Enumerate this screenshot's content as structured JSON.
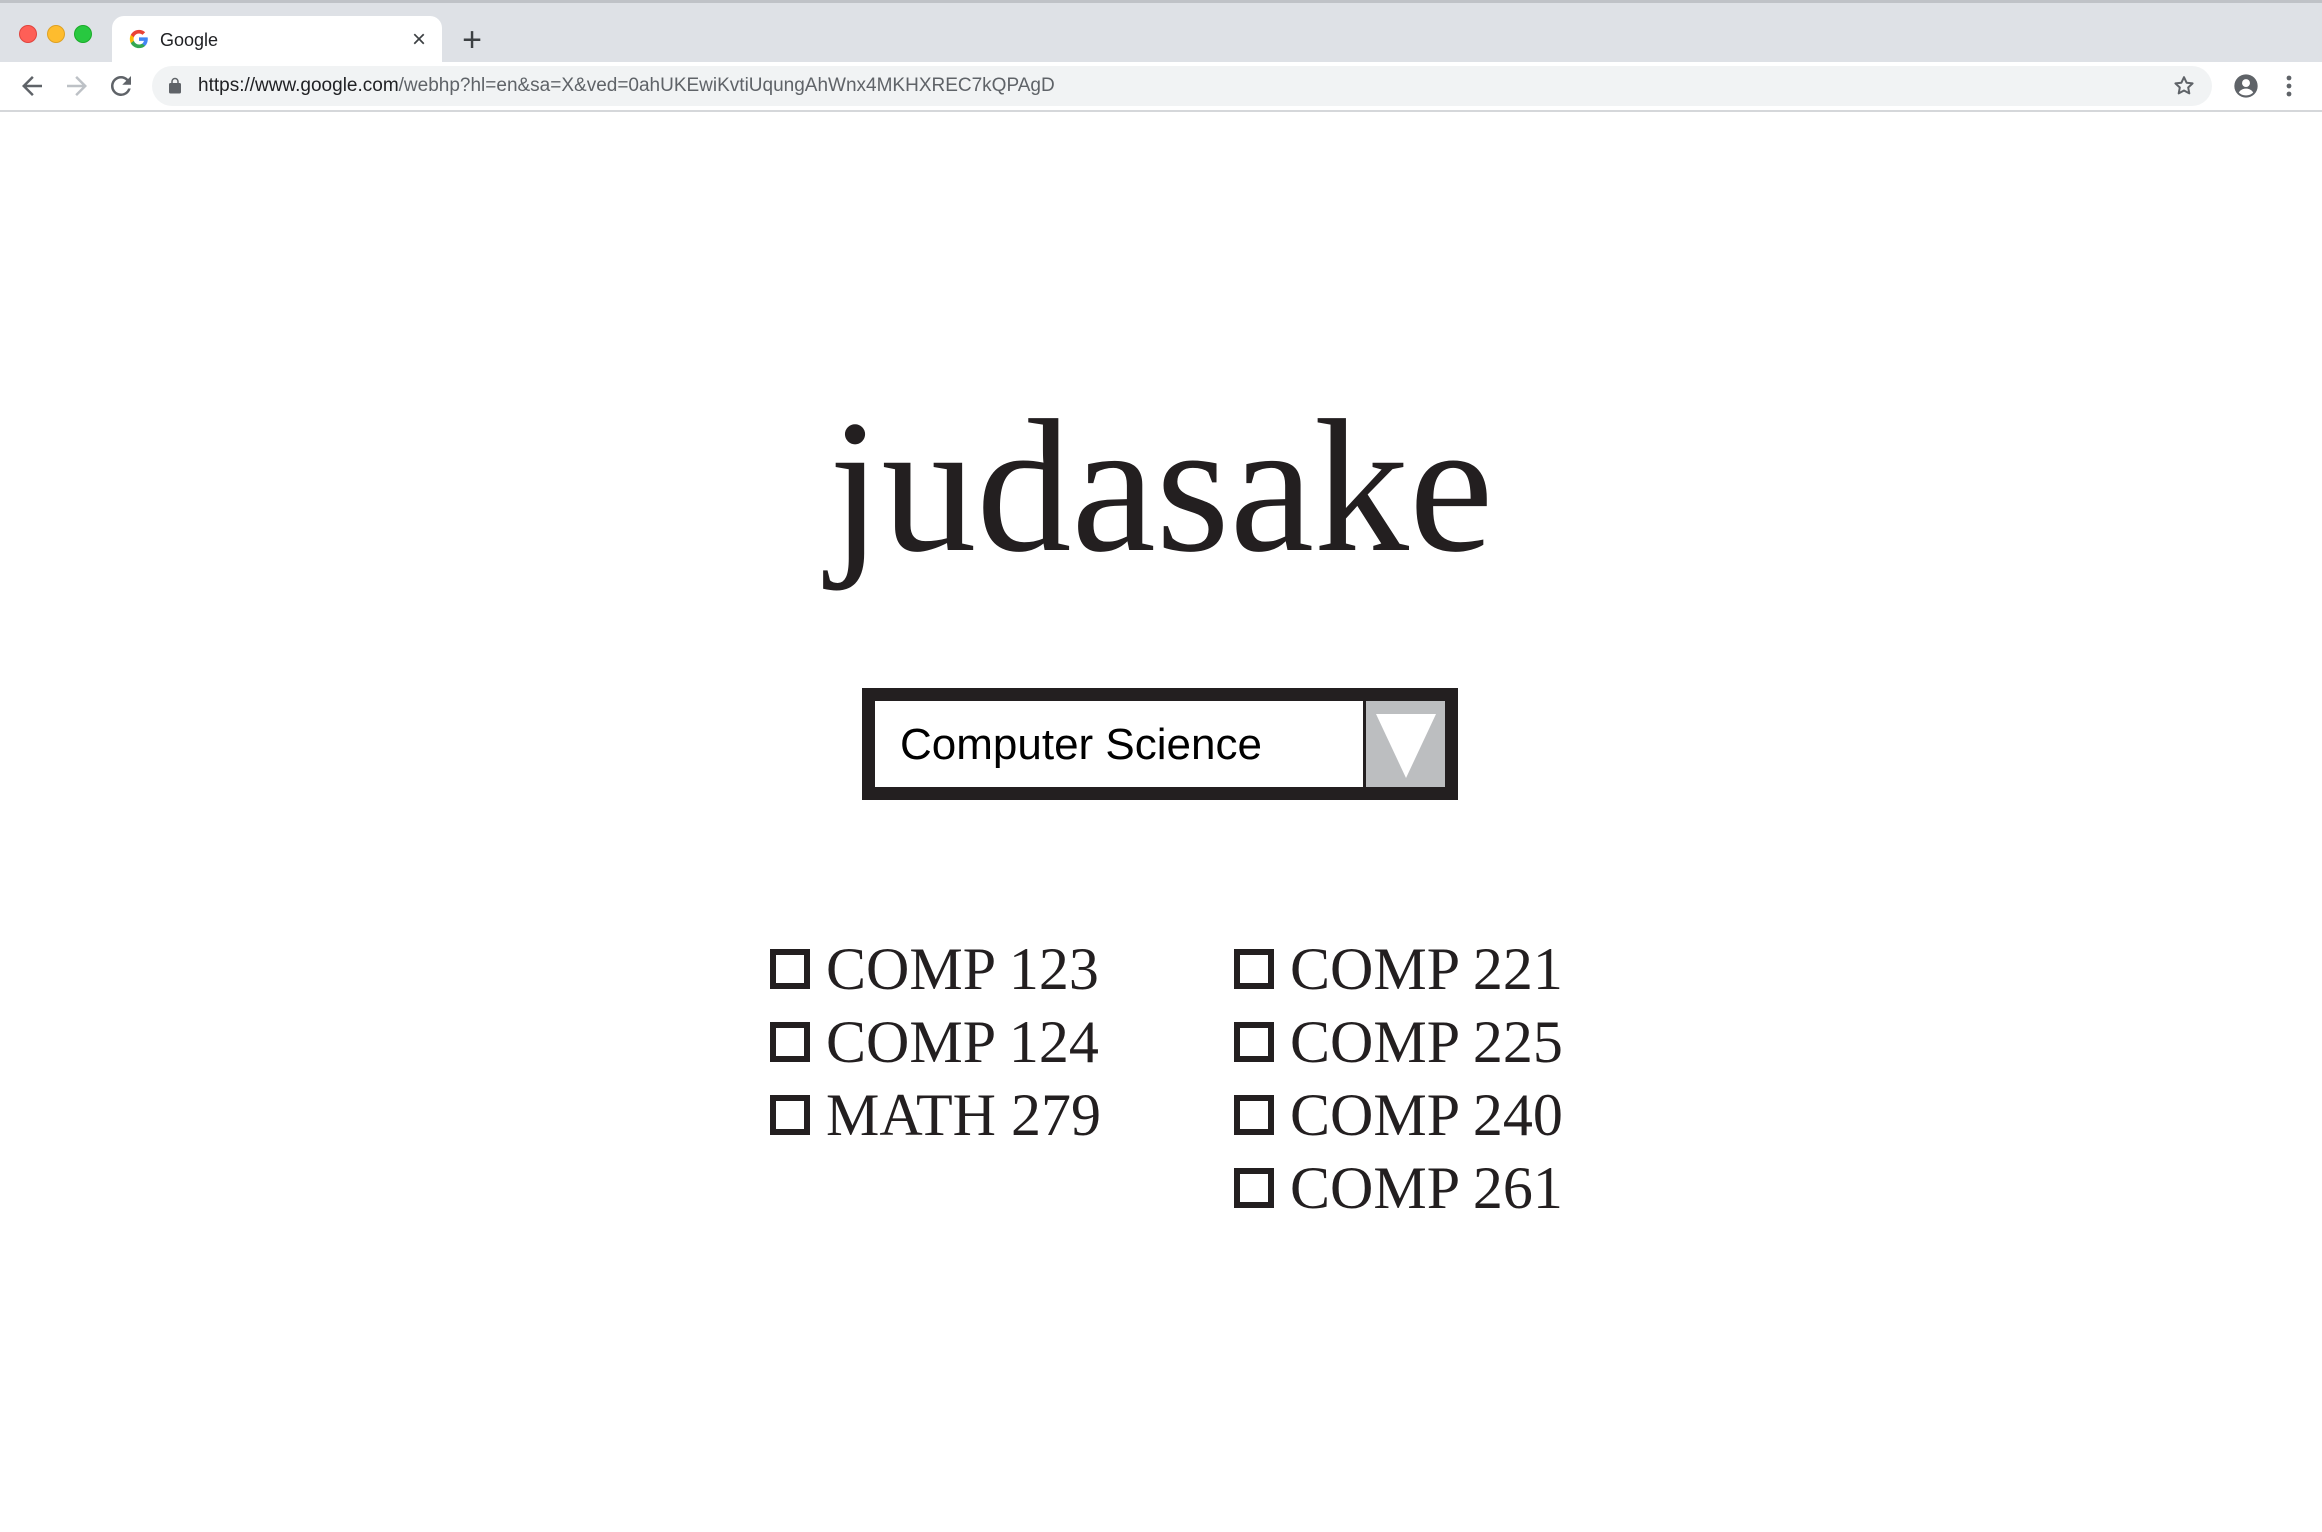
{
  "browser": {
    "tab": {
      "title": "Google",
      "close_glyph": "×",
      "favicon": "google-g-icon"
    },
    "new_tab_glyph": "+",
    "address_bar": {
      "url_host": "https://www.google.com",
      "url_path": "/webhp?hl=en&sa=X&ved=0ahUKEwiKvtiUqungAhWnx4MKHXREC7kQPAgD"
    },
    "icons": {
      "back": "back-arrow-icon",
      "forward": "forward-arrow-icon",
      "reload": "reload-icon",
      "lock": "lock-icon",
      "star": "bookmark-star-icon",
      "profile": "profile-icon",
      "menu": "kebab-menu-icon"
    }
  },
  "page": {
    "title": "judasake",
    "department_select": {
      "selected": "Computer Science"
    },
    "courses": {
      "left": [
        {
          "label": "COMP 123",
          "checked": false
        },
        {
          "label": "COMP 124",
          "checked": false
        },
        {
          "label": "MATH 279",
          "checked": false
        }
      ],
      "right": [
        {
          "label": "COMP 221",
          "checked": false
        },
        {
          "label": "COMP 225",
          "checked": false
        },
        {
          "label": "COMP 240",
          "checked": false
        },
        {
          "label": "COMP 261",
          "checked": false
        }
      ]
    }
  },
  "colors": {
    "ink": "#231f20",
    "select_button": "#bcbec0",
    "chrome_tabstrip": "#dee1e6",
    "omnibox": "#f1f3f4"
  }
}
